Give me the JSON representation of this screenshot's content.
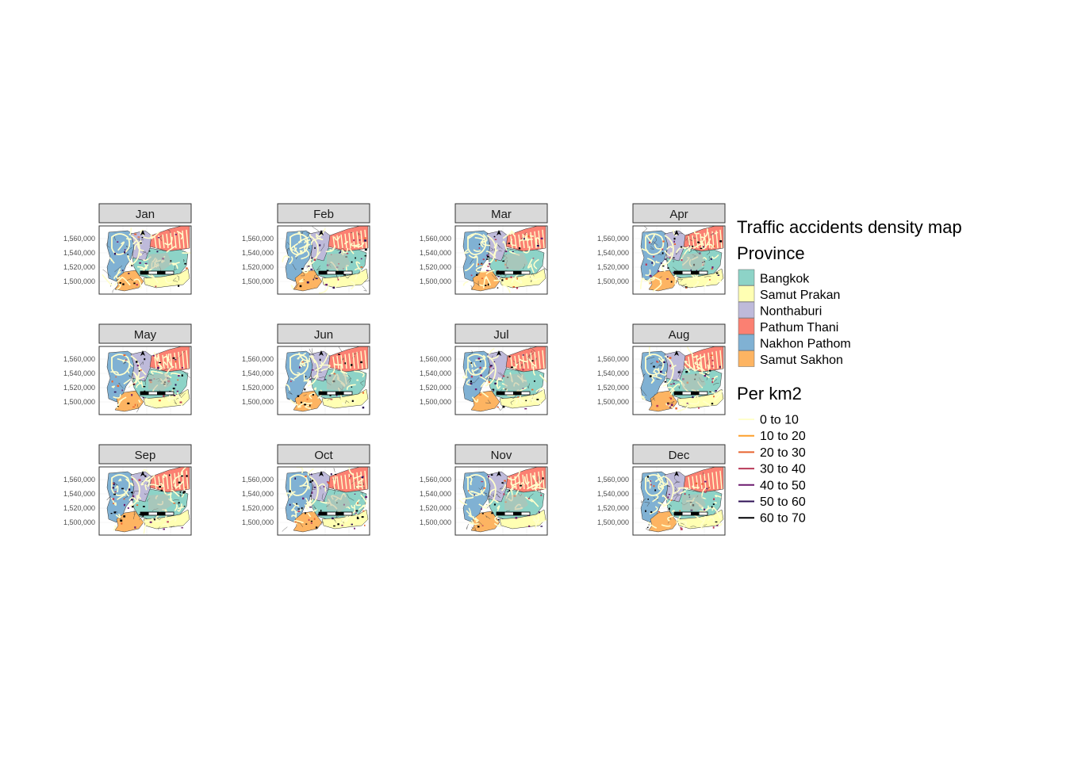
{
  "title": "Traffic accidents density map",
  "panels": [
    "Jan",
    "Feb",
    "Mar",
    "Apr",
    "May",
    "Jun",
    "Jul",
    "Aug",
    "Sep",
    "Oct",
    "Nov",
    "Dec"
  ],
  "y_ticks": [
    "1,560,000",
    "1,540,000",
    "1,520,000",
    "1,500,000"
  ],
  "legend_province": {
    "title": "Province",
    "items": [
      {
        "label": "Bangkok",
        "color": "#8dd3c7"
      },
      {
        "label": "Samut Prakan",
        "color": "#ffffb3"
      },
      {
        "label": "Nonthaburi",
        "color": "#bebada"
      },
      {
        "label": "Pathum Thani",
        "color": "#fb8072"
      },
      {
        "label": "Nakhon Pathom",
        "color": "#80b1d3"
      },
      {
        "label": "Samut Sakhon",
        "color": "#fdb462"
      }
    ]
  },
  "legend_density": {
    "title": "Per km2",
    "items": [
      {
        "label": "0 to 10",
        "color": "#ffffcc"
      },
      {
        "label": "10 to 20",
        "color": "#fd9f2c"
      },
      {
        "label": "20 to 30",
        "color": "#e8642f"
      },
      {
        "label": "30 to 40",
        "color": "#b93a58"
      },
      {
        "label": "40 to 50",
        "color": "#6b1a6e"
      },
      {
        "label": "50 to 60",
        "color": "#2c0f55"
      },
      {
        "label": "60 to 70",
        "color": "#000004"
      }
    ]
  }
}
